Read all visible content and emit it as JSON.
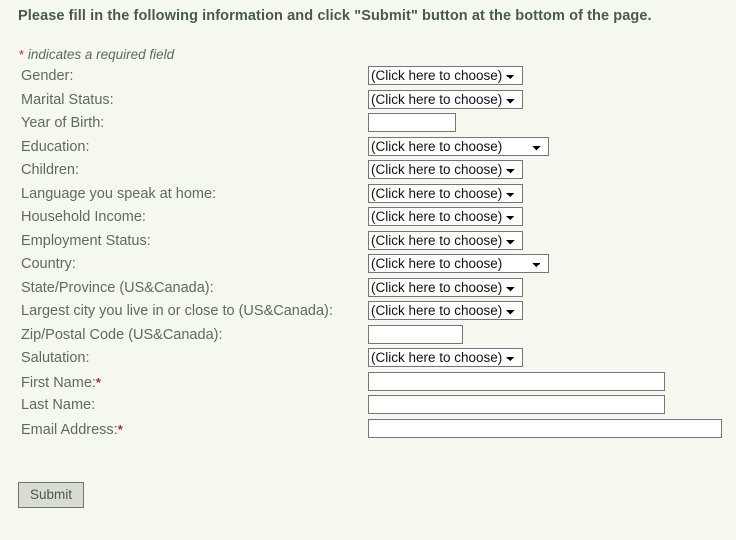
{
  "page": {
    "intro": "Please fill in the following information and click \"Submit\" button at the bottom of the page.",
    "required_note": "indicates a required field",
    "required_marker": "*",
    "colors": {
      "background": "#f5f8ef",
      "label_text": "#5e6b5e",
      "heading_text": "#4a5a4a",
      "required_star": "#cc2222",
      "field_border": "#767676",
      "button_face": "#d8dcd2"
    }
  },
  "form": {
    "select_placeholder": "(Click here to choose)",
    "fields": [
      {
        "label": "Gender:",
        "required": false,
        "type": "select",
        "value": "(Click here to choose)",
        "width": "std",
        "name": "gender"
      },
      {
        "label": "Marital Status:",
        "required": false,
        "type": "select",
        "value": "(Click here to choose)",
        "width": "std",
        "name": "marital-status"
      },
      {
        "label": "Year of Birth:",
        "required": false,
        "type": "text",
        "value": "",
        "placeholder": "",
        "width": "year",
        "name": "year-of-birth"
      },
      {
        "label": "Education:",
        "required": false,
        "type": "select",
        "value": "(Click here to choose)",
        "width": "wide",
        "name": "education"
      },
      {
        "label": "Children:",
        "required": false,
        "type": "select",
        "value": "(Click here to choose)",
        "width": "std",
        "name": "children"
      },
      {
        "label": "Language you speak at home:",
        "required": false,
        "type": "select",
        "value": "(Click here to choose)",
        "width": "std",
        "name": "language-at-home"
      },
      {
        "label": "Household Income:",
        "required": false,
        "type": "select",
        "value": "(Click here to choose)",
        "width": "std",
        "name": "household-income"
      },
      {
        "label": "Employment Status:",
        "required": false,
        "type": "select",
        "value": "(Click here to choose)",
        "width": "std",
        "name": "employment-status"
      },
      {
        "label": "Country:",
        "required": false,
        "type": "select",
        "value": "(Click here to choose)",
        "width": "wide",
        "name": "country"
      },
      {
        "label": "State/Province (US&Canada):",
        "required": false,
        "type": "select",
        "value": "(Click here to choose)",
        "width": "std",
        "name": "state-province"
      },
      {
        "label": "Largest city you live in or close to (US&Canada):",
        "required": false,
        "type": "select",
        "value": "(Click here to choose)",
        "width": "std",
        "name": "largest-city"
      },
      {
        "label": "Zip/Postal Code (US&Canada):",
        "required": false,
        "type": "text",
        "value": "",
        "placeholder": "",
        "width": "zip",
        "name": "zip-postal-code"
      },
      {
        "label": "Salutation:",
        "required": false,
        "type": "select",
        "value": "(Click here to choose)",
        "width": "std",
        "name": "salutation"
      },
      {
        "label": "First Name:",
        "required": true,
        "type": "text",
        "value": "",
        "placeholder": "",
        "width": "name",
        "name": "first-name"
      },
      {
        "label": "Last Name:",
        "required": false,
        "type": "text",
        "value": "",
        "placeholder": "",
        "width": "name",
        "name": "last-name"
      },
      {
        "label": "Email Address:",
        "required": true,
        "type": "text",
        "value": "",
        "placeholder": "",
        "width": "email",
        "name": "email-address"
      }
    ]
  },
  "actions": {
    "submit_label": "Submit"
  }
}
